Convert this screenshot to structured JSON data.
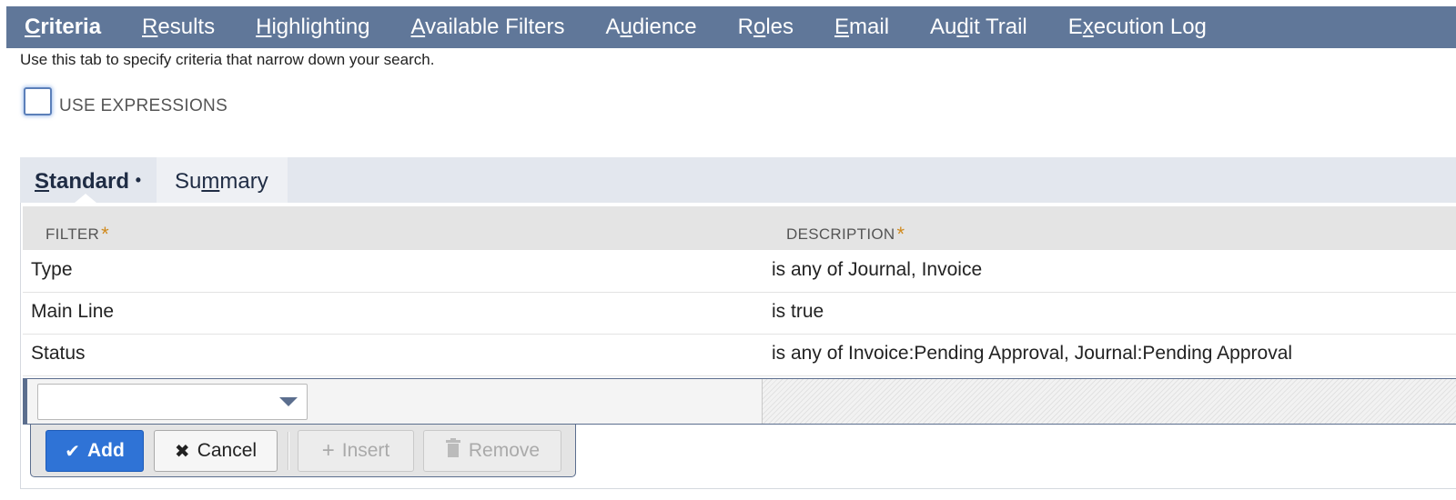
{
  "top_tabs": [
    {
      "label_pre": "",
      "label_key": "C",
      "label_post": "riteria",
      "active": true
    },
    {
      "label_pre": "",
      "label_key": "R",
      "label_post": "esults",
      "active": false
    },
    {
      "label_pre": "",
      "label_key": "H",
      "label_post": "ighlighting",
      "active": false
    },
    {
      "label_pre": "",
      "label_key": "A",
      "label_post": "vailable Filters",
      "active": false
    },
    {
      "label_pre": "A",
      "label_key": "u",
      "label_post": "dience",
      "active": false
    },
    {
      "label_pre": "R",
      "label_key": "o",
      "label_post": "les",
      "active": false
    },
    {
      "label_pre": "",
      "label_key": "E",
      "label_post": "mail",
      "active": false
    },
    {
      "label_pre": "Au",
      "label_key": "d",
      "label_post": "it Trail",
      "active": false
    },
    {
      "label_pre": "E",
      "label_key": "x",
      "label_post": "ecution Log",
      "active": false
    }
  ],
  "help_text": "Use this tab to specify criteria that narrow down your search.",
  "use_expressions": {
    "label": "USE EXPRESSIONS",
    "checked": false
  },
  "sub_tabs": {
    "standard": {
      "key": "S",
      "rest": "tandard",
      "marker": "•"
    },
    "summary": {
      "pre": "Su",
      "key": "m",
      "rest": "mary"
    }
  },
  "table": {
    "headers": [
      {
        "label": "FILTER",
        "required": "*"
      },
      {
        "label": "DESCRIPTION",
        "required": "*"
      }
    ],
    "rows": [
      {
        "filter": "Type",
        "description": "is any of Journal, Invoice"
      },
      {
        "filter": "Main Line",
        "description": "is true"
      },
      {
        "filter": "Status",
        "description": "is any of Invoice:Pending Approval, Journal:Pending Approval"
      }
    ]
  },
  "actions": {
    "add": "Add",
    "cancel": "Cancel",
    "insert": "Insert",
    "remove": "Remove"
  },
  "colors": {
    "topbar": "#607799",
    "accent": "#2f73d6",
    "required_star": "#d08a1e"
  }
}
